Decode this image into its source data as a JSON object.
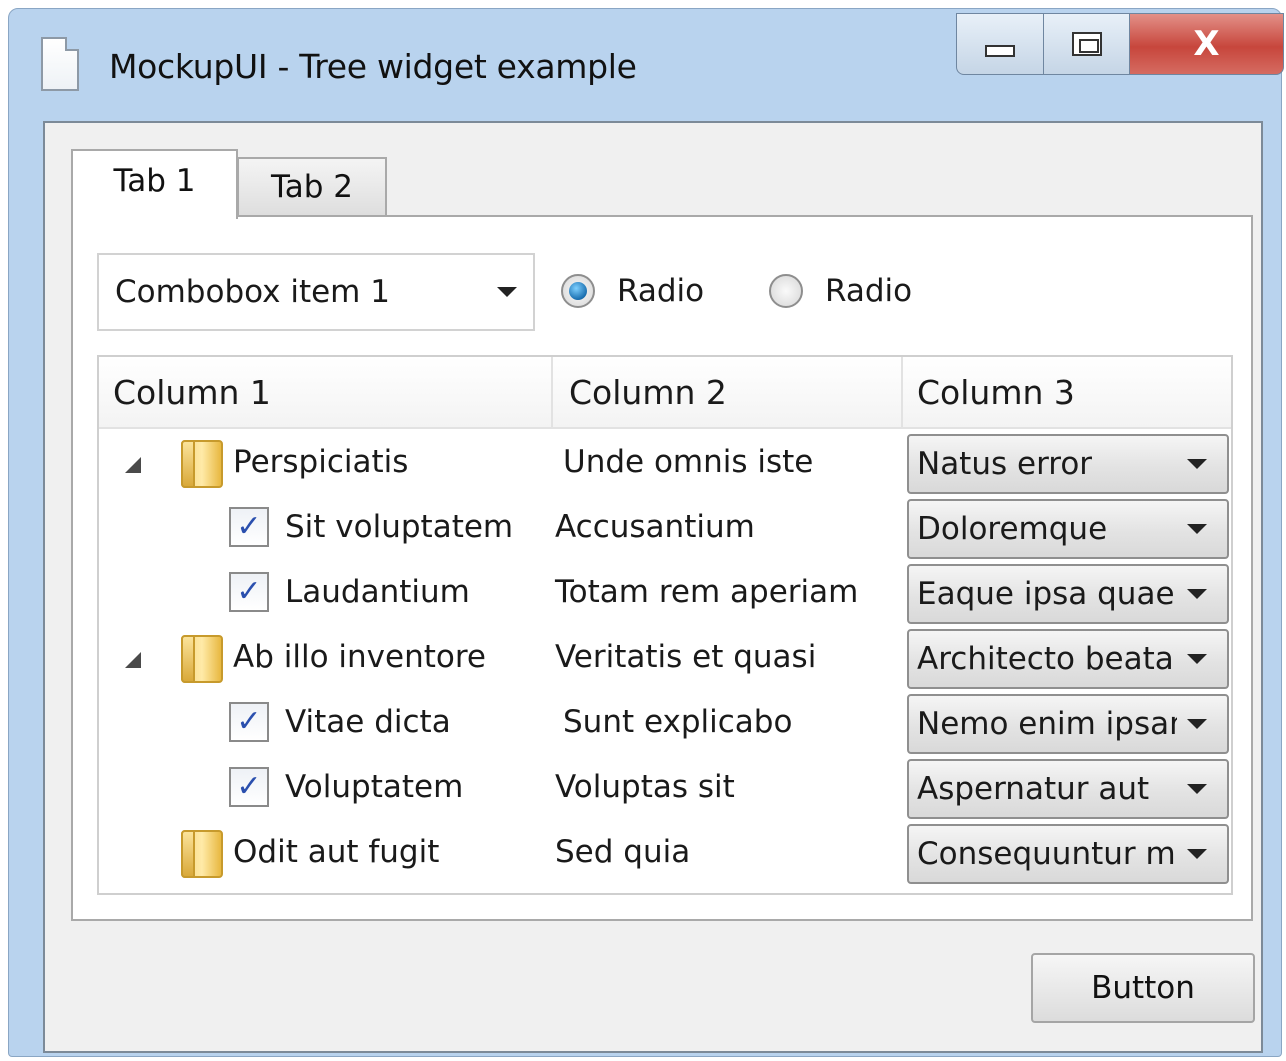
{
  "window": {
    "title": "MockupUI - Tree widget example",
    "close_glyph": "X",
    "icons": {
      "document": "document-icon",
      "minimize": "minimize-icon",
      "maximize": "maximize-icon",
      "close": "close-icon"
    }
  },
  "tabs": [
    {
      "label": "Tab 1",
      "active": true
    },
    {
      "label": "Tab 2",
      "active": false
    }
  ],
  "combobox": {
    "value": "Combobox item 1"
  },
  "radios": [
    {
      "label": "Radio",
      "checked": true
    },
    {
      "label": "Radio",
      "checked": false
    }
  ],
  "tree": {
    "columns": [
      "Column 1",
      "Column 2",
      "Column 3"
    ],
    "rows": [
      {
        "level": 0,
        "type": "folder",
        "expanded": true,
        "col1": "Perspiciatis",
        "col2": "Unde omnis iste",
        "col3": "Natus error"
      },
      {
        "level": 1,
        "type": "checkbox",
        "checked": true,
        "col1": "Sit voluptatem",
        "col2": "Accusantium",
        "col3": "Doloremque"
      },
      {
        "level": 1,
        "type": "checkbox",
        "checked": true,
        "col1": "Laudantium",
        "col2": "Totam rem aperiam",
        "col3": "Eaque ipsa quae"
      },
      {
        "level": 0,
        "type": "folder",
        "expanded": true,
        "col1": "Ab illo inventore",
        "col2": "Veritatis et quasi",
        "col3": "Architecto beata"
      },
      {
        "level": 1,
        "type": "checkbox",
        "checked": true,
        "col1": "Vitae dicta",
        "col2": "Sunt explicabo",
        "col3": "Nemo enim ipsam"
      },
      {
        "level": 1,
        "type": "checkbox",
        "checked": true,
        "col1": "Voluptatem",
        "col2": "Voluptas sit",
        "col3": "Aspernatur aut"
      },
      {
        "level": 0,
        "type": "folder",
        "expanded": false,
        "col1": "Odit aut fugit",
        "col2": "Sed quia",
        "col3": "Consequuntur m"
      }
    ]
  },
  "button": {
    "label": "Button"
  },
  "check_glyph": "✓"
}
